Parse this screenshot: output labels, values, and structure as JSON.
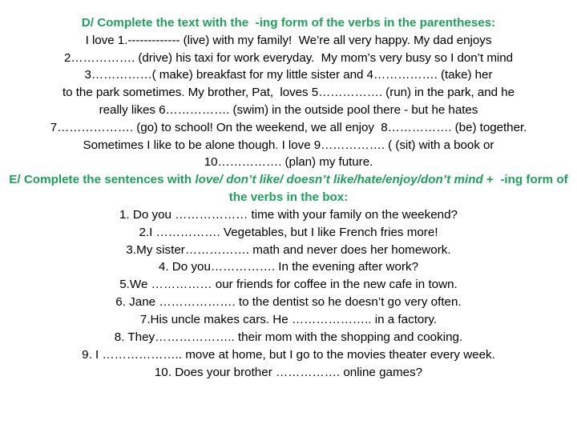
{
  "slide": {
    "accent_green": "#1FA05A",
    "text_color": "#000000",
    "background": "#ffffff"
  },
  "section_d": {
    "heading": "D/ Complete the text with the  -ing form of the verbs in the parentheses:",
    "lines": [
      "I love 1.------------- (live) with my family!  We’re all very happy. My dad enjoys",
      "2……………. (drive) his taxi for work everyday.  My mom’s very busy so I don’t mind",
      "3……………( make) breakfast for my little sister and 4……………. (take) her",
      "to the park sometimes. My brother, Pat,  loves 5……………. (run) in the park, and he",
      "really likes 6……………. (swim) in the outside pool there - but he hates",
      "7………………. (go) to school! On the weekend, we all enjoy  8……………. (be) together.",
      "Sometimes I like to be alone though. I love 9……………. ( (sit) with a book or",
      "10……………. (plan) my future."
    ]
  },
  "section_e": {
    "heading_part1": "E/ Complete the sentences with ",
    "heading_italic": "love/ don’t like/ doesn’t like/hate/enjoy/don’t mind",
    "heading_part2": " +  -ing form of the verbs in the box:",
    "items": [
      "1. Do you ……………… time with your family on the weekend?",
      "2.I ……………. Vegetables, but I like French fries more!",
      "3.My sister……………. math and never does her homework.",
      "4. Do you……………. In the evening after work?",
      "5.We …………… our friends for coffee in the new cafe in town.",
      "6. Jane ………………. to the dentist so he doesn’t go very often.",
      "7.His uncle makes cars. He ……………….. in a factory.",
      "8. They……………….. their mom with the shopping and cooking.",
      "9. I ……………….. move at home, but I go to the movies theater every week.",
      "10. Does your brother ……………. online games?"
    ]
  }
}
